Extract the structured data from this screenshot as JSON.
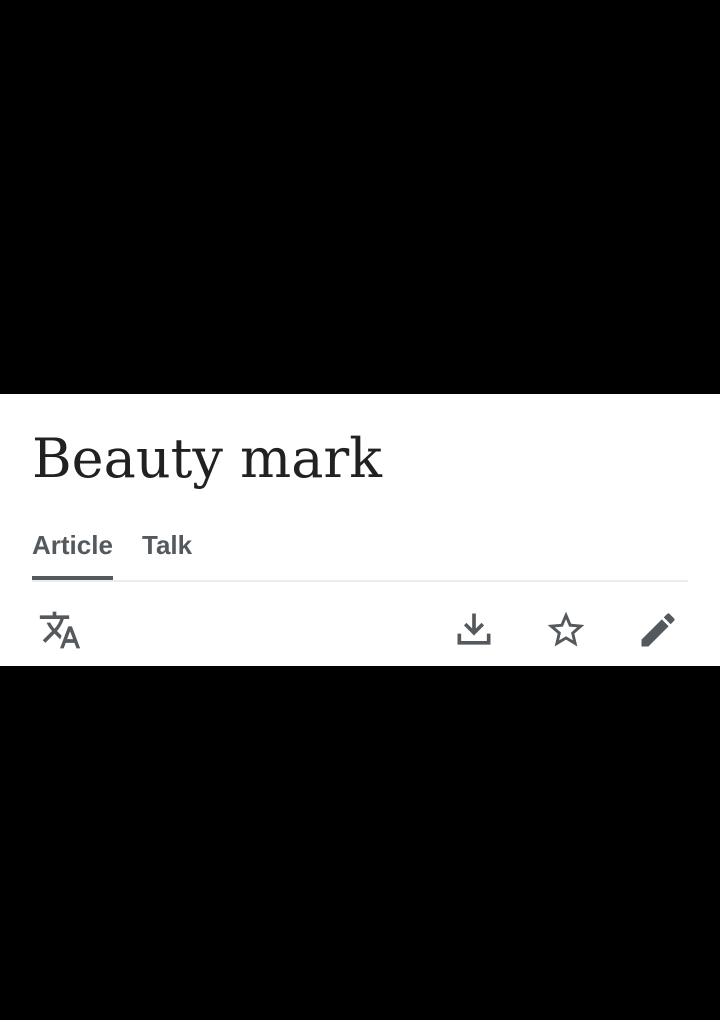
{
  "article": {
    "title": "Beauty mark"
  },
  "tabs": [
    {
      "label": "Article",
      "selected": true
    },
    {
      "label": "Talk",
      "selected": false
    }
  ],
  "toolbar": {
    "actions": [
      {
        "name": "language",
        "icon": "translate-icon"
      },
      {
        "name": "download",
        "icon": "download-icon"
      },
      {
        "name": "watch",
        "icon": "star-outline-icon"
      },
      {
        "name": "edit",
        "icon": "pencil-icon"
      }
    ]
  },
  "colors": {
    "background": "#000000",
    "panel": "#ffffff",
    "title_text": "#202122",
    "tab_text": "#54595d",
    "divider": "#eaecf0",
    "icon": "#54595d"
  }
}
